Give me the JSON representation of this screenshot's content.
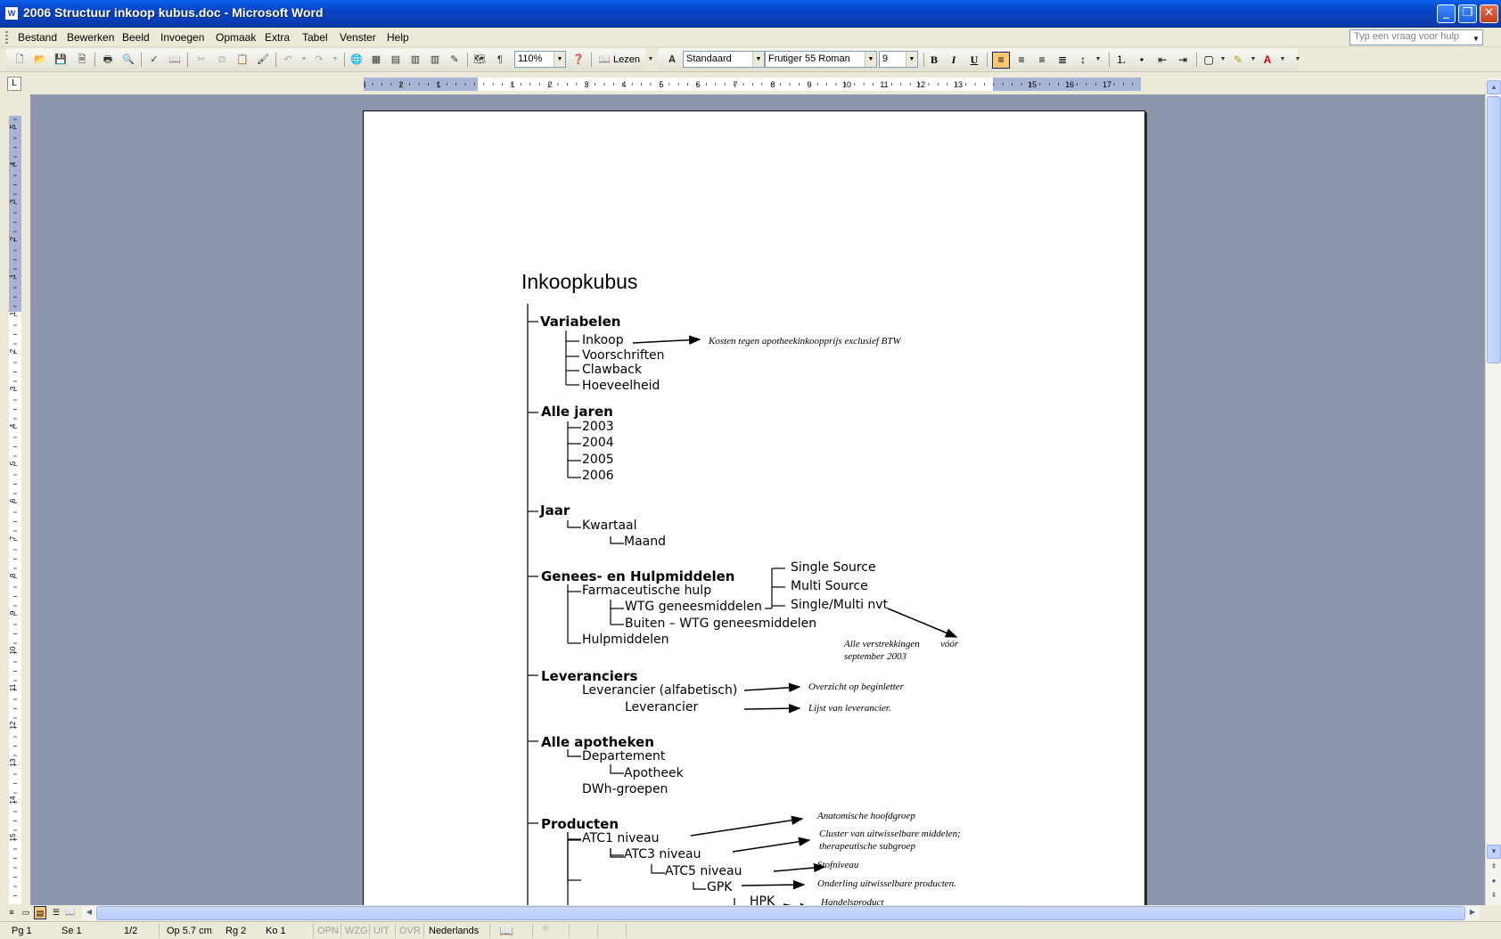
{
  "window": {
    "title": "2006 Structuur inkoop kubus.doc - Microsoft Word",
    "app_icon": "W"
  },
  "menu": {
    "items": [
      "Bestand",
      "Bewerken",
      "Beeld",
      "Invoegen",
      "Opmaak",
      "Extra",
      "Tabel",
      "Venster",
      "Help"
    ],
    "help_placeholder": "Typ een vraag voor hulp"
  },
  "toolbar": {
    "zoom": "110%",
    "read_label": "Lezen",
    "style": "Standaard",
    "font": "Frutiger 55 Roman",
    "size": "9",
    "bold": "B",
    "italic": "I",
    "underline": "U",
    "font_color_letter": "A"
  },
  "ruler": {
    "h_labels": [
      "3",
      "2",
      "1",
      "1",
      "2",
      "3",
      "4",
      "5",
      "6",
      "7",
      "8",
      "9",
      "10",
      "11",
      "12",
      "13",
      "15",
      "16",
      "17"
    ],
    "v_labels": [
      "5",
      "4",
      "3",
      "2",
      "1",
      "1",
      "2",
      "3",
      "4",
      "5",
      "6",
      "7",
      "8",
      "9",
      "10",
      "11",
      "12",
      "13",
      "14",
      "15"
    ]
  },
  "document": {
    "title": "Inkoopkubus",
    "sections": [
      {
        "heading": "Variabelen",
        "items": [
          "Inkoop",
          "Voorschriften",
          "Clawback",
          "Hoeveelheid"
        ]
      },
      {
        "heading": "Alle jaren",
        "items": [
          "2003",
          "2004",
          "2005",
          "2006"
        ]
      },
      {
        "heading": "Jaar",
        "items": [
          "Kwartaal",
          "Maand"
        ]
      },
      {
        "heading": "Genees- en Hulpmiddelen",
        "items": [
          "Farmaceutische hulp",
          "WTG geneesmiddelen",
          "Buiten  – WTG geneesmiddelen",
          "Hulpmiddelen",
          "Single Source",
          "Multi Source",
          "Single/Multi nvt"
        ]
      },
      {
        "heading": "Leveranciers",
        "items": [
          "Leverancier (alfabetisch)",
          "Leverancier"
        ]
      },
      {
        "heading": "Alle apotheken",
        "items": [
          "Departement",
          "Apotheek",
          "DWh-groepen"
        ]
      },
      {
        "heading": "Producten",
        "items": [
          "ATC1 niveau",
          "ATC3 niveau",
          "ATC5 niveau",
          "GPK",
          "HPK"
        ]
      }
    ],
    "notes": {
      "inkoop": "Kosten tegen apotheekinkoopprijs exclusief BTW",
      "alle1": "Alle verstrekkingen",
      "voor": "vóór",
      "alle2": "september  2003",
      "overzicht": "Overzicht op beginletter",
      "lijst": "Lijst van leverancier.",
      "atc1": "Anatomische hoofdgroep",
      "atc3a": "Cluster van uitwisselbare middelen;",
      "atc3b": "therapeutische subgroep",
      "atc5": "Stofniveau",
      "gpk": "Onderling uitwisselbare producten.",
      "hpk": "Handelsproduct"
    }
  },
  "status": {
    "page": "Pg 1",
    "section": "Se 1",
    "pages": "1/2",
    "position": "Op  5.7 cm",
    "line": "Rg  2",
    "column": "Ko  1",
    "rec": "OPN",
    "trk": "WZG",
    "ext": "UIT",
    "ovr": "OVR",
    "language": "Nederlands"
  }
}
